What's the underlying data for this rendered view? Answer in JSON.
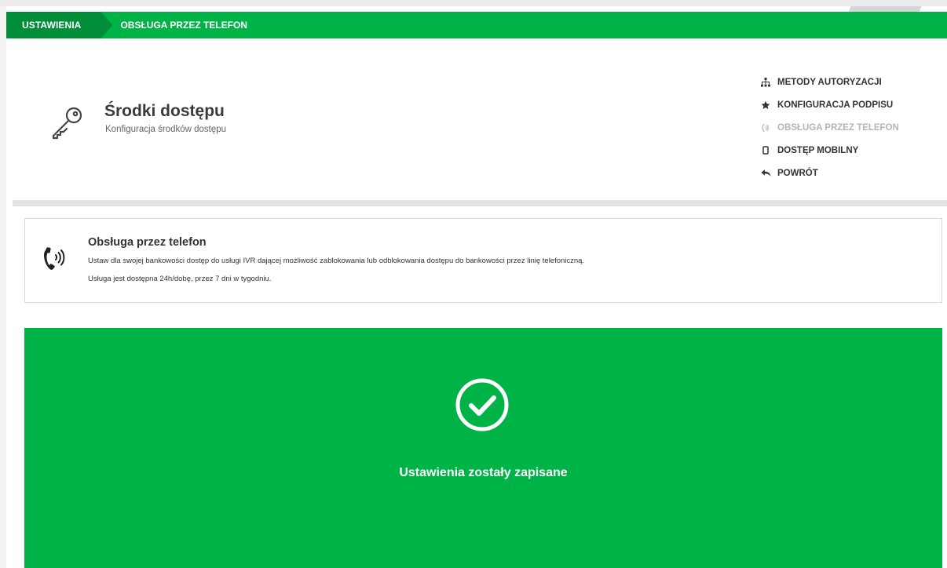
{
  "breadcrumb": {
    "root": "USTAWIENIA",
    "current": "OBSŁUGA PRZEZ TELEFON"
  },
  "header": {
    "title": "Środki dostępu",
    "subtitle": "Konfiguracja środków dostępu",
    "icon": "key-icon"
  },
  "nav": {
    "items": [
      {
        "label": "METODY AUTORYZACJI",
        "icon": "sitemap-icon"
      },
      {
        "label": "KONFIGURACJA PODPISU",
        "icon": "star-icon"
      },
      {
        "label": "OBSŁUGA PRZEZ TELEFON",
        "icon": "phone-volume-icon"
      },
      {
        "label": "DOSTĘP MOBILNY",
        "icon": "mobile-icon"
      },
      {
        "label": "POWRÓT",
        "icon": "reply-icon"
      }
    ]
  },
  "info": {
    "title": "Obsługa przez telefon",
    "line1": "Ustaw dla swojej bankowości dostęp do usługi IVR dającej możliwość zablokowania lub odblokowania dostępu do bankowości przez linię telefoniczną.",
    "line2": "Usługa jest dostępna 24h/dobę, przez 7 dni w tygodniu.",
    "icon": "phone-volume-icon"
  },
  "success": {
    "message": "Ustawienia zostały zapisane",
    "icon": "check-circle-icon"
  },
  "colors": {
    "brand_green": "#00b347",
    "dark_green": "#008f38",
    "disabled_text": "#b5b5b5"
  }
}
